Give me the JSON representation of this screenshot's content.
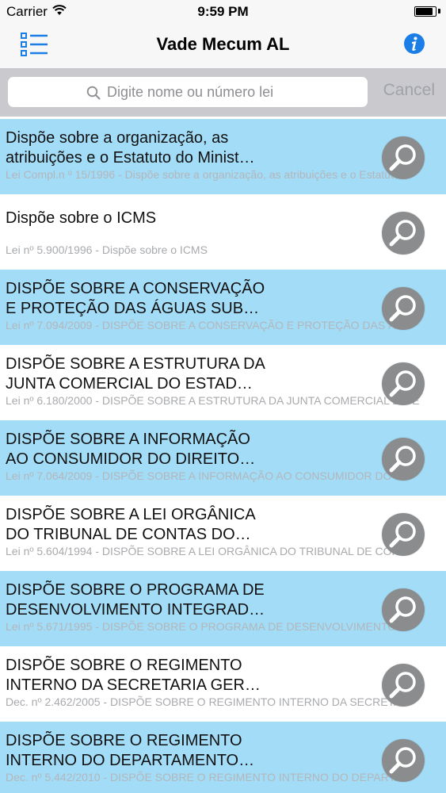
{
  "status_bar": {
    "carrier": "Carrier",
    "time": "9:59 PM",
    "battery_level": 0.95
  },
  "nav": {
    "title": "Vade Mecum AL",
    "menu_icon": "list-menu-icon",
    "info_icon": "info-icon",
    "accent_color": "#1a7ee6"
  },
  "search": {
    "placeholder": "Digite nome ou número lei",
    "value": "",
    "cancel_label": "Cancel"
  },
  "colors": {
    "row_highlight": "#a3dcf7",
    "row_plain": "#ffffff",
    "magnifier_button": "#8a8c8e"
  },
  "items": [
    {
      "title": "Dispõe sobre a organização, as\natribuições e o Estatuto do Minist…",
      "subtitle": "Lei Compl.n º 15/1996 - Dispõe sobre a organização, as atribuições e o Estatuto"
    },
    {
      "title": "Dispõe sobre o ICMS",
      "subtitle": "Lei nº 5.900/1996 - Dispõe sobre o ICMS"
    },
    {
      "title": "DISPÕE SOBRE A CONSERVAÇÃO\nE PROTEÇÃO DAS ÁGUAS SUB…",
      "subtitle": "Lei nº 7.094/2009 - DISPÕE SOBRE A CONSERVAÇÃO E PROTEÇÃO DAS ÁG"
    },
    {
      "title": "DISPÕE SOBRE A ESTRUTURA DA\nJUNTA COMERCIAL DO ESTAD…",
      "subtitle": "Lei nº 6.180/2000 - DISPÕE SOBRE A ESTRUTURA DA JUNTA COMERCIAL DO E"
    },
    {
      "title": "DISPÕE SOBRE A INFORMAÇÃO\nAO CONSUMIDOR DO DIREITO…",
      "subtitle": "Lei nº 7.064/2009 - DISPÕE SOBRE A INFORMAÇÃO AO CONSUMIDOR DO D"
    },
    {
      "title": "DISPÕE SOBRE A LEI ORGÂNICA\nDO TRIBUNAL DE CONTAS DO…",
      "subtitle": "Lei nº 5.604/1994 - DISPÕE SOBRE A LEI ORGÂNICA DO TRIBUNAL DE CON"
    },
    {
      "title": "DISPÕE SOBRE O PROGRAMA DE\nDESENVOLVIMENTO INTEGRAD…",
      "subtitle": "Lei nº 5.671/1995 - DISPÕE SOBRE O PROGRAMA DE DESENVOLVIMENTO I"
    },
    {
      "title": "DISPÕE SOBRE O REGIMENTO\nINTERNO DA SECRETARIA GER…",
      "subtitle": "Dec. nº 2.462/2005 - DISPÕE SOBRE O REGIMENTO INTERNO DA SECRETA"
    },
    {
      "title": "DISPÕE SOBRE O REGIMENTO\nINTERNO DO DEPARTAMENTO…",
      "subtitle": "Dec. nº 5.442/2010 - DISPÕE SOBRE O REGIMENTO INTERNO DO DEPARTA"
    }
  ]
}
